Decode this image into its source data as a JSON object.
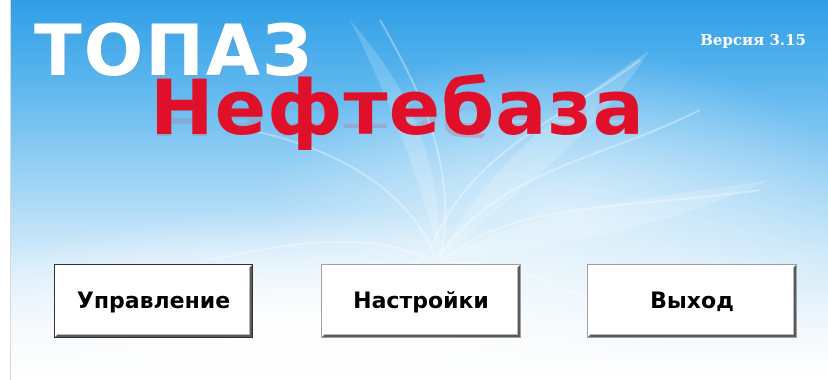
{
  "logo": {
    "line1": "ТОПАЗ",
    "line2": "Нефтебаза"
  },
  "version": "Версия 3.15",
  "buttons": {
    "manage": "Управление",
    "settings": "Настройки",
    "exit": "Выход"
  },
  "colors": {
    "accent_red": "#e0102a",
    "sky_blue": "#2f9ee6"
  }
}
